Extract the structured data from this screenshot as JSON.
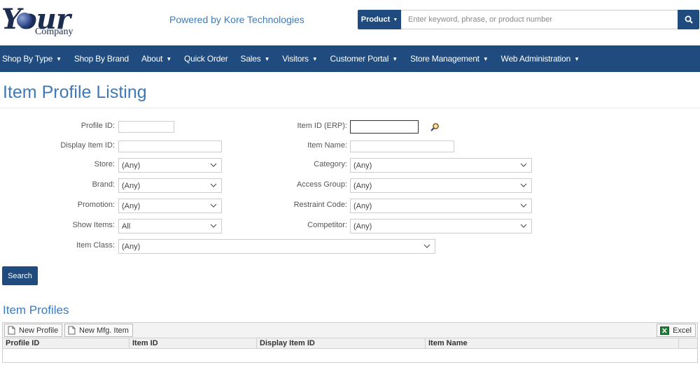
{
  "brand": {
    "logo_main": "Your",
    "logo_sub": "Company",
    "tagline": "Powered by Kore Technologies"
  },
  "search": {
    "scope_label": "Product",
    "placeholder": "Enter keyword, phrase, or product number"
  },
  "nav": [
    {
      "label": "Shop By Type",
      "dropdown": true
    },
    {
      "label": "Shop By Brand",
      "dropdown": false
    },
    {
      "label": "About",
      "dropdown": true
    },
    {
      "label": "Quick Order",
      "dropdown": false
    },
    {
      "label": "Sales",
      "dropdown": true
    },
    {
      "label": "Visitors",
      "dropdown": true
    },
    {
      "label": "Customer Portal",
      "dropdown": true
    },
    {
      "label": "Store Management",
      "dropdown": true
    },
    {
      "label": "Web Administration",
      "dropdown": true
    }
  ],
  "page": {
    "title": "Item Profile Listing"
  },
  "form": {
    "profile_id": {
      "label": "Profile ID:",
      "value": ""
    },
    "item_id_erp": {
      "label": "Item ID (ERP):",
      "value": ""
    },
    "display_item_id": {
      "label": "Display Item ID:",
      "value": ""
    },
    "item_name": {
      "label": "Item Name:",
      "value": ""
    },
    "store": {
      "label": "Store:",
      "value": "(Any)"
    },
    "category": {
      "label": "Category:",
      "value": "(Any)"
    },
    "brand": {
      "label": "Brand:",
      "value": "(Any)"
    },
    "access_group": {
      "label": "Access Group:",
      "value": "(Any)"
    },
    "promotion": {
      "label": "Promotion:",
      "value": "(Any)"
    },
    "restraint_code": {
      "label": "Restraint Code:",
      "value": "(Any)"
    },
    "show_items": {
      "label": "Show Items:",
      "value": "All"
    },
    "competitor": {
      "label": "Competitor:",
      "value": "(Any)"
    },
    "item_class": {
      "label": "Item Class:",
      "value": "(Any)"
    },
    "search_label": "Search"
  },
  "results": {
    "title": "Item Profiles",
    "toolbar": {
      "new_profile": "New Profile",
      "new_mfg_item": "New Mfg. Item",
      "excel": "Excel"
    },
    "columns": [
      "Profile ID",
      "Item ID",
      "Display Item ID",
      "Item Name"
    ]
  },
  "colors": {
    "primary": "#1f4b7e",
    "accent_text": "#3e7ab8"
  }
}
